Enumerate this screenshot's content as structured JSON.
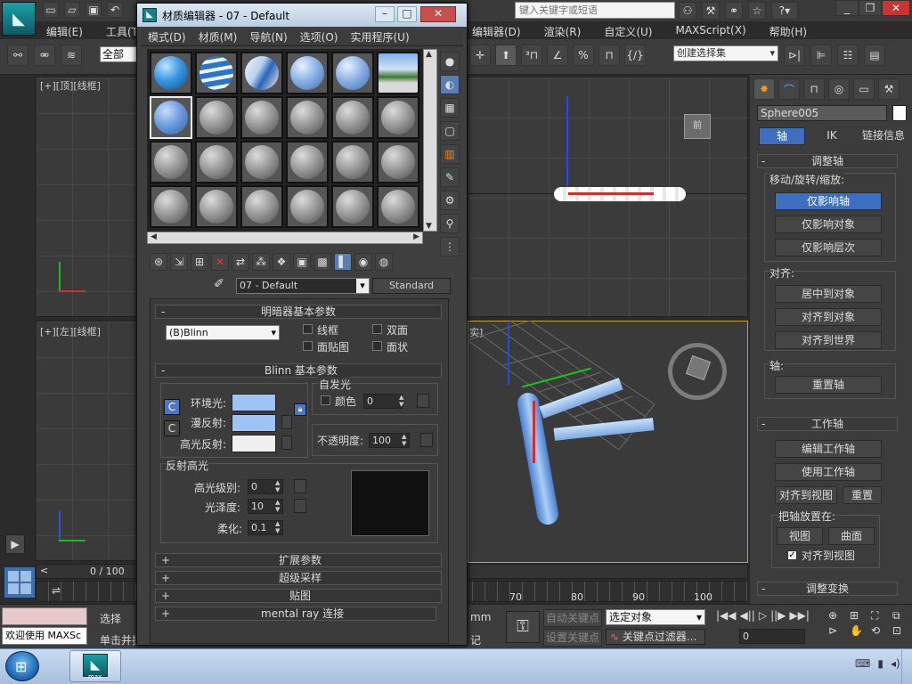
{
  "app": {
    "search_placeholder": "键入关键字或短语",
    "menu": [
      "编辑(E)",
      "工具(T"
    ],
    "menu_right": [
      "编辑器(D)",
      "渲染(R)",
      "自定义(U)",
      "MAXScript(X)",
      "帮助(H)"
    ],
    "selection_filter": "全部",
    "named_selection": "创建选择集"
  },
  "viewports": {
    "top_label": "[+][顶][线框]",
    "left_label": "[+][左][线框]",
    "persp_fragment": "实]"
  },
  "right_panel": {
    "object_name": "Sphere005",
    "tabs": [
      "轴",
      "IK",
      "链接信息"
    ],
    "adjust_pivot": {
      "title": "调整轴",
      "move_rotate_scale": "移动/旋转/缩放:",
      "btn_pivot_only": "仅影响轴",
      "btn_object_only": "仅影响对象",
      "btn_hierarchy_only": "仅影响层次"
    },
    "align": {
      "title": "对齐:",
      "center": "居中到对象",
      "align_object": "对齐到对象",
      "align_world": "对齐到世界"
    },
    "pivot": {
      "title": "轴:",
      "reset": "重置轴"
    },
    "working_pivot": {
      "title": "工作轴",
      "edit": "编辑工作轴",
      "use": "使用工作轴",
      "align_view": "对齐到视图",
      "reset": "重置",
      "place_on": "把轴放置在:",
      "view": "视图",
      "surface": "曲面",
      "align_to_view": "对齐到视图"
    },
    "adjust_transform": {
      "title": "调整变换"
    }
  },
  "timeline": {
    "progress": "0 / 100",
    "ticks": [
      "70",
      "80",
      "90",
      "100"
    ]
  },
  "status": {
    "welcome": "欢迎使用 MAXSc",
    "select": "选择",
    "click_drag": "单击并拦",
    "units": "mm",
    "auto_key": "自动关键点",
    "set_key": "设置关键点",
    "key_mode": "选定对象",
    "key_filters": "关键点过滤器...",
    "frame": "0",
    "add_time": "记"
  },
  "material_editor": {
    "title": "材质编辑器 - 07 - Default",
    "menu": [
      "模式(D)",
      "材质(M)",
      "导航(N)",
      "选项(O)",
      "实用程序(U)"
    ],
    "material_name": "07 - Default",
    "material_type": "Standard",
    "shader_basic": {
      "title": "明暗器基本参数",
      "shader": "(B)Blinn",
      "wire": "线框",
      "two_sided": "双面",
      "face_map": "面贴图",
      "faceted": "面状"
    },
    "blinn_basic": {
      "title": "Blinn 基本参数",
      "self_illum": "自发光",
      "color_label": "颜色",
      "color_value": "0",
      "ambient": "环境光:",
      "diffuse": "漫反射:",
      "specular": "高光反射:",
      "opacity_label": "不透明度:",
      "opacity": "100",
      "ambient_color": "#9ec4f5",
      "diffuse_color": "#9ec4f5",
      "specular_color": "#f0f0f0",
      "spec_c": "C",
      "lock_c": "C"
    },
    "spec_highlights": {
      "title": "反射高光",
      "level_label": "高光级别:",
      "level": "0",
      "gloss_label": "光泽度:",
      "gloss": "10",
      "soften_label": "柔化:",
      "soften": "0.1"
    },
    "rollouts": [
      "扩展参数",
      "超级采样",
      "贴图",
      "mental ray 连接"
    ]
  },
  "taskbar": {
    "app_label": "max"
  }
}
